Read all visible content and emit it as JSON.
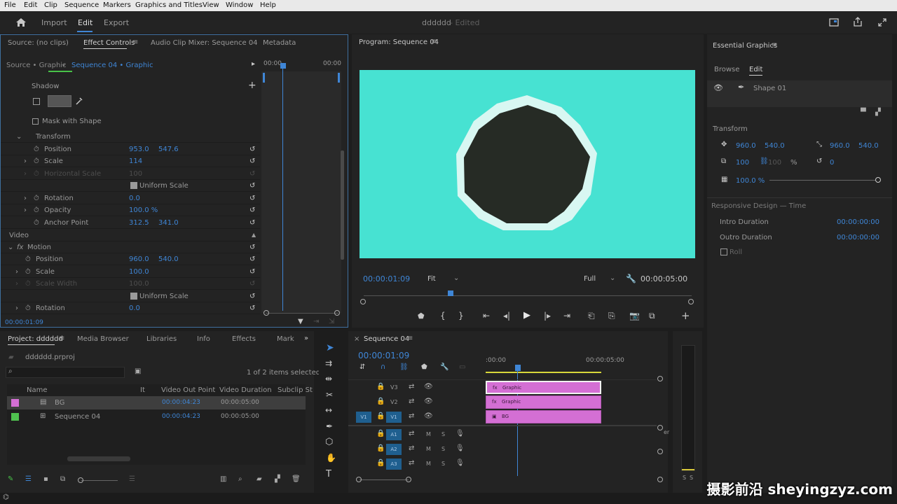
{
  "menu": [
    "File",
    "Edit",
    "Clip",
    "Sequence",
    "Markers",
    "Graphics and Titles",
    "View",
    "Window",
    "Help"
  ],
  "top": {
    "import": "Import",
    "edit": "Edit",
    "export": "Export",
    "title": "dddddd",
    "edited": "- Edited"
  },
  "ec": {
    "source": "Source: (no clips)",
    "effect_controls": "Effect Controls",
    "audio_mixer": "Audio Clip Mixer: Sequence 04",
    "metadata": "Metadata",
    "source_graphic": "Source • Graphic",
    "seq_graphic": "Sequence 04 • Graphic",
    "t0": "00:00",
    "t1": "00:00",
    "shadow": "Shadow",
    "mask": "Mask with Shape",
    "transform": "Transform",
    "position": "Position",
    "pos_x": "953.0",
    "pos_y": "547.6",
    "scale": "Scale",
    "scale_v": "114",
    "hscale": "Horizontal Scale",
    "hscale_v": "100",
    "uniform": "Uniform Scale",
    "rotation": "Rotation",
    "rot_v": "0.0",
    "opacity": "Opacity",
    "opacity_v": "100.0 %",
    "anchor": "Anchor Point",
    "anc_x": "312.5",
    "anc_y": "341.0",
    "video": "Video",
    "motion": "Motion",
    "m_position": "Position",
    "m_pos_x": "960.0",
    "m_pos_y": "540.0",
    "m_scale": "Scale",
    "m_scale_v": "100.0",
    "m_sw": "Scale Width",
    "m_sw_v": "100.0",
    "m_uniform": "Uniform Scale",
    "m_rotation": "Rotation",
    "m_rot_v": "0.0",
    "timecode": "00:00:01:09"
  },
  "program": {
    "title": "Program: Sequence 04",
    "timecode": "00:00:01:09",
    "fit": "Fit",
    "full": "Full",
    "duration": "00:00:05:00"
  },
  "eg": {
    "title": "Essential Graphics",
    "browse": "Browse",
    "edit": "Edit",
    "layer": "Shape 01",
    "transform": "Transform",
    "px": "960.0",
    "py": "540.0",
    "ax": "960.0",
    "ay": "540.0",
    "sc": "100",
    "sc2": "100",
    "pct": "%",
    "rot": "0",
    "opacity": "100.0 %",
    "responsive": "Responsive Design — Time",
    "intro": "Intro Duration",
    "intro_v": "00:00:00:00",
    "outro": "Outro Duration",
    "outro_v": "00:00:00:00",
    "roll": "Roll"
  },
  "project": {
    "tab": "Project: dddddd",
    "media": "Media Browser",
    "libraries": "Libraries",
    "info": "Info",
    "effects": "Effects",
    "markers": "Mark",
    "file": "dddddd.prproj",
    "count": "1 of 2 items selected",
    "col_name": "Name",
    "col_out": "Video Out Point",
    "col_dur": "Video Duration",
    "col_sub": "Subclip St",
    "col_fr": "It",
    "items": [
      {
        "name": "BG",
        "out": "00:00:04:23",
        "dur": "00:00:05:00",
        "color": "#d46fd4"
      },
      {
        "name": "Sequence 04",
        "out": "00:00:04:23",
        "dur": "00:00:05:00",
        "color": "#4fc14f"
      }
    ]
  },
  "timeline": {
    "tab": "Sequence 04",
    "timecode": "00:00:01:09",
    "t0": ":00:00",
    "t1": "00:00:05:00",
    "tracks": [
      {
        "name": "V3",
        "clip": "Graphic"
      },
      {
        "name": "V2",
        "clip": "Graphic"
      },
      {
        "name": "V1",
        "clip": "BG"
      }
    ],
    "audio": [
      "A1",
      "A2",
      "A3"
    ],
    "src": "V1",
    "m": "M",
    "s": "S",
    "er": "er"
  },
  "meter": {
    "s1": "S",
    "s2": "S"
  },
  "watermark": "摄影前沿 sheyingzyz.com",
  "colors": {
    "accent": "#3f86d6",
    "program_bg": "#47e2d2",
    "shape_fill": "#262b25",
    "shape_stroke": "#d8f7f2",
    "clip": "#d46fd4"
  }
}
